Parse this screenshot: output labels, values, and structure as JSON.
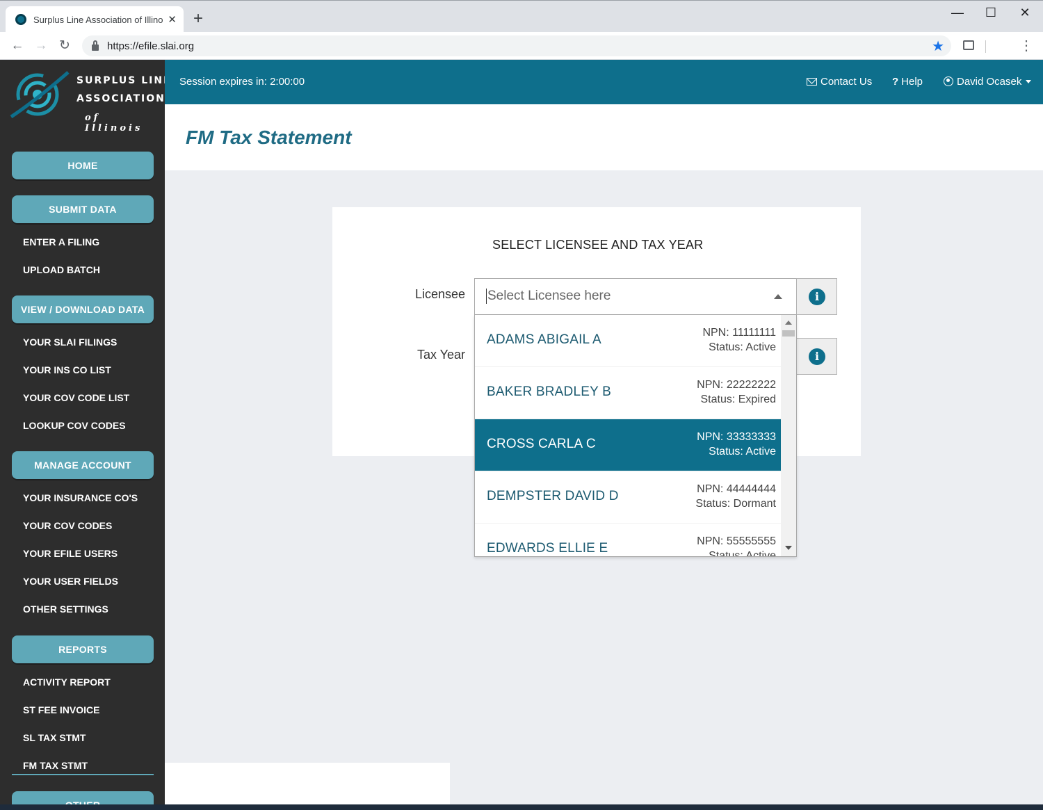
{
  "browser": {
    "tab_title": "Surplus Line Association of Illinois",
    "url": "https://efile.slai.org",
    "new_tab": "+",
    "tab_close": "✕",
    "minimize": "—",
    "maximize": "☐",
    "close": "✕",
    "back": "←",
    "forward": "→",
    "reload": "↻",
    "star": "★",
    "menu": "⋮"
  },
  "logo": {
    "line1": "SURPLUS LINE",
    "line2": "ASSOCIATION",
    "line3": "of Illinois"
  },
  "sidebar": {
    "home": "HOME",
    "submit_data": "SUBMIT DATA",
    "enter_filing": "ENTER A FILING",
    "upload_batch": "UPLOAD BATCH",
    "view_download": "VIEW / DOWNLOAD DATA",
    "slai_filings": "YOUR SLAI FILINGS",
    "ins_co_list": "YOUR INS CO LIST",
    "cov_code_list": "YOUR COV CODE LIST",
    "lookup_cov": "LOOKUP COV CODES",
    "manage_account": "MANAGE ACCOUNT",
    "insurance_cos": "YOUR INSURANCE CO'S",
    "cov_codes": "YOUR COV CODES",
    "efile_users": "YOUR EFILE USERS",
    "user_fields": "YOUR USER FIELDS",
    "other_settings": "OTHER SETTINGS",
    "reports": "REPORTS",
    "activity_report": "ACTIVITY REPORT",
    "st_fee_invoice": "ST FEE INVOICE",
    "sl_tax_stmt": "SL TAX STMT",
    "fm_tax_stmt": "FM TAX STMT",
    "other": "OTHER"
  },
  "header": {
    "session": "Session expires in: 2:00:00",
    "contact": "Contact Us",
    "help_icon": "?",
    "help": "Help",
    "user": "David Ocasek"
  },
  "page": {
    "title": "FM Tax Statement",
    "card_heading": "SELECT LICENSEE AND TAX YEAR",
    "licensee_label": "Licensee",
    "tax_year_label": "Tax Year",
    "licensee_placeholder": "Select Licensee here",
    "info_glyph": "i"
  },
  "licensees": [
    {
      "name": "ADAMS ABIGAIL A",
      "npn": "NPN: 11111111",
      "status": "Status: Active"
    },
    {
      "name": "BAKER BRADLEY B",
      "npn": "NPN: 22222222",
      "status": "Status: Expired"
    },
    {
      "name": "CROSS CARLA C",
      "npn": "NPN: 33333333",
      "status": "Status: Active"
    },
    {
      "name": "DEMPSTER DAVID D",
      "npn": "NPN: 44444444",
      "status": "Status: Dormant"
    },
    {
      "name": "EDWARDS ELLIE E",
      "npn": "NPN: 55555555",
      "status": "Status: Active"
    }
  ],
  "colors": {
    "brand_teal": "#0e6f8c",
    "sidebar_button": "#5fa8b8",
    "sidebar_bg": "#2d2d2d",
    "title_color": "#1f6b84"
  },
  "icons": {
    "contact": "mail-icon",
    "help": "question-icon",
    "user": "user-circle-icon",
    "info": "info-icon"
  }
}
